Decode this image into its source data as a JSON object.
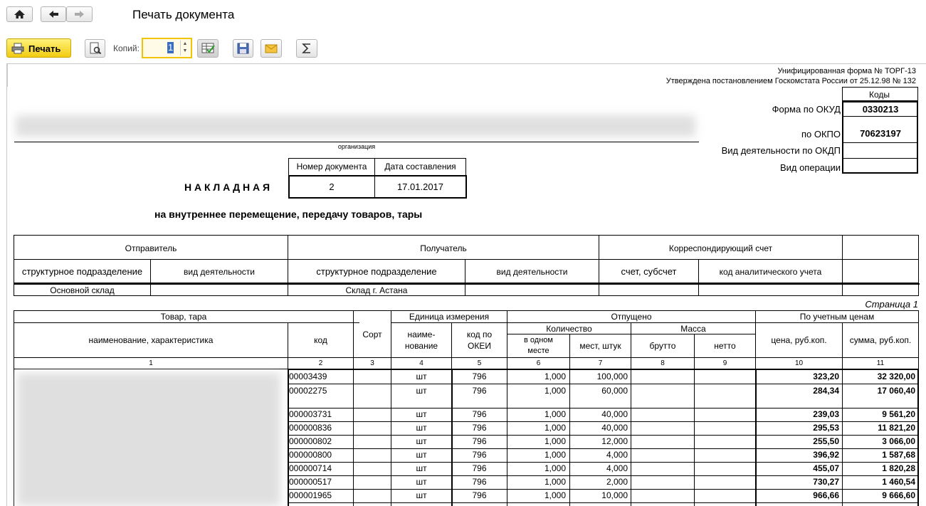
{
  "window": {
    "title": "Печать документа"
  },
  "toolbar": {
    "print_label": "Печать",
    "copies_label": "Копий:",
    "copies_value": "1"
  },
  "form": {
    "unified": "Унифицированная форма № ТОРГ-13",
    "approved": "Утверждена постановлением Госкомстата России от 25.12.98 № 132",
    "codes_header": "Коды",
    "okud_label": "Форма по ОКУД",
    "okud_value": "0330213",
    "okpo_label": "по ОКПО",
    "okpo_value": "70623197",
    "okdp_label": "Вид деятельности по ОКДП",
    "operation_label": "Вид операции",
    "org_caption": "организация",
    "doc_title": "Н А К Л А Д Н А Я",
    "doc_number_header": "Номер документа",
    "doc_date_header": "Дата составления",
    "doc_number": "2",
    "doc_date": "17.01.2017",
    "subtitle": "на внутреннее перемещение, передачу товаров, тары"
  },
  "parties": {
    "sender": "Отправитель",
    "receiver": "Получатель",
    "account": "Корреспондирующий счет",
    "sender_unit": "структурное подразделение",
    "sender_activity": "вид деятельности",
    "receiver_unit": "структурное подразделение",
    "receiver_activity": "вид деятельности",
    "account_sub": "счет, субсчет",
    "analytic_code": "код аналитического учета",
    "sender_value": "Основной склад",
    "receiver_value": "Склад г. Астана"
  },
  "table": {
    "page": "Страница 1",
    "h_goods": "Товар, тара",
    "h_name": "наименование, характеристика",
    "h_code": "код",
    "h_sort": "Сорт",
    "h_unit": "Единица измерения",
    "h_unit_name_1": "наиме-",
    "h_unit_name_2": "нование",
    "h_okei_1": "код по",
    "h_okei_2": "ОКЕИ",
    "h_released": "Отпущено",
    "h_quantity": "Количество",
    "h_mass": "Масса",
    "h_per_place_1": "в одном",
    "h_per_place_2": "месте",
    "h_places": "мест, штук",
    "h_gross": "брутто",
    "h_net": "нетто",
    "h_prices": "По учетным ценам",
    "h_price": "цена, руб.коп.",
    "h_sum": "сумма, руб.коп.",
    "col_numbers": [
      "1",
      "2",
      "3",
      "4",
      "5",
      "6",
      "7",
      "8",
      "9",
      "10",
      "11"
    ],
    "rows": [
      {
        "code": "00003439",
        "unit": "шт",
        "okei": "796",
        "per_place": "1,000",
        "places": "100,000",
        "price": "323,20",
        "sum": "32 320,00"
      },
      {
        "code": "00002275",
        "unit": "шт",
        "okei": "796",
        "per_place": "1,000",
        "places": "60,000",
        "price": "284,34",
        "sum": "17 060,40"
      },
      {
        "code": "000003731",
        "unit": "шт",
        "okei": "796",
        "per_place": "1,000",
        "places": "40,000",
        "price": "239,03",
        "sum": "9 561,20"
      },
      {
        "code": "000000836",
        "unit": "шт",
        "okei": "796",
        "per_place": "1,000",
        "places": "40,000",
        "price": "295,53",
        "sum": "11 821,20"
      },
      {
        "code": "000000802",
        "unit": "шт",
        "okei": "796",
        "per_place": "1,000",
        "places": "12,000",
        "price": "255,50",
        "sum": "3 066,00"
      },
      {
        "code": "000000800",
        "unit": "шт",
        "okei": "796",
        "per_place": "1,000",
        "places": "4,000",
        "price": "396,92",
        "sum": "1 587,68"
      },
      {
        "code": "000000714",
        "unit": "шт",
        "okei": "796",
        "per_place": "1,000",
        "places": "4,000",
        "price": "455,07",
        "sum": "1 820,28"
      },
      {
        "code": "000000517",
        "unit": "шт",
        "okei": "796",
        "per_place": "1,000",
        "places": "2,000",
        "price": "730,27",
        "sum": "1 460,54"
      },
      {
        "code": "000001965",
        "unit": "шт",
        "okei": "796",
        "per_place": "1,000",
        "places": "10,000",
        "price": "966,66",
        "sum": "9 666,60"
      }
    ]
  }
}
